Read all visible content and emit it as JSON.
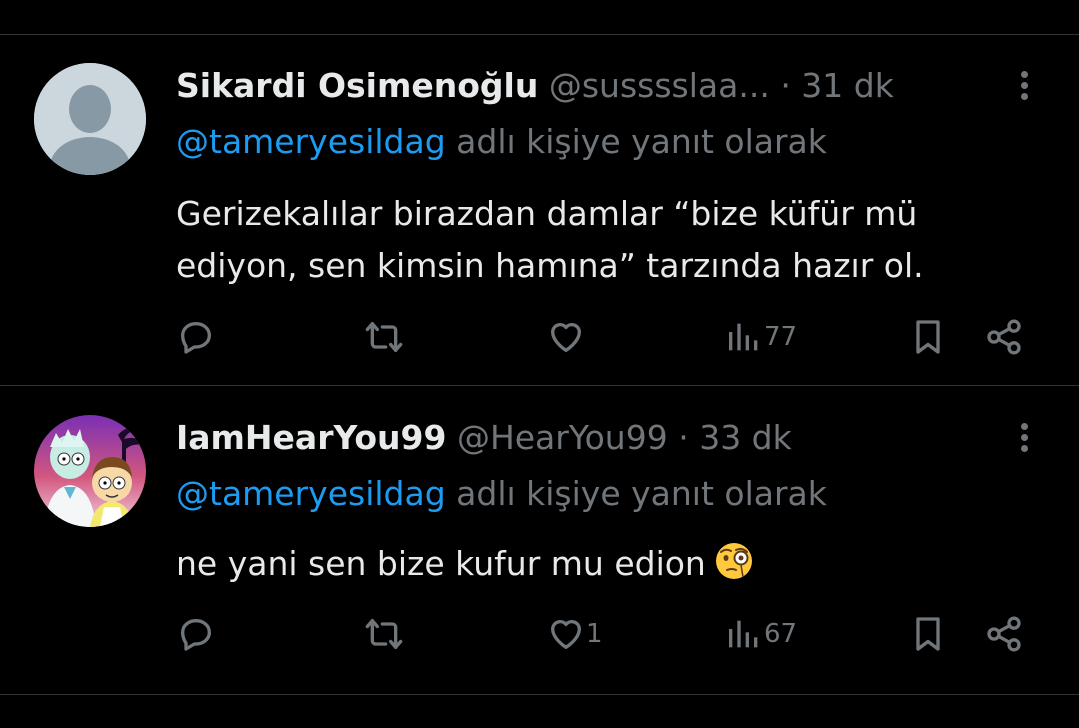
{
  "tweets": [
    {
      "display_name": "Sikardi Osimenoğlu",
      "handle": "@susssslaa...",
      "time": "· 31 dk",
      "reply_mention": "@tameryesildag",
      "reply_suffix": "adlı kişiye yanıt olarak",
      "text_line1": "Gerizekalılar birazdan damlar “bize küfür mü",
      "text_line2": "ediyon, sen kimsin hamına” tarzında hazır ol.",
      "avatar": "default-avatar",
      "replies": "",
      "retweets": "",
      "likes": "",
      "views": "77"
    },
    {
      "display_name": "IamHearYou99",
      "handle": "@HearYou99",
      "time": "· 33 dk",
      "reply_mention": "@tameryesildag",
      "reply_suffix": "adlı kişiye yanıt olarak",
      "text_line1": "ne yani sen bize kufur mu edion",
      "avatar": "cartoon-avatar",
      "emoji": "monocle-face-emoji",
      "replies": "",
      "retweets": "",
      "likes": "1",
      "views": "67"
    }
  ],
  "colors": {
    "background": "#000000",
    "primary_text": "#e7e9ea",
    "secondary_text": "#71767b",
    "mention": "#1d9bf0",
    "divider": "#2f3336"
  }
}
